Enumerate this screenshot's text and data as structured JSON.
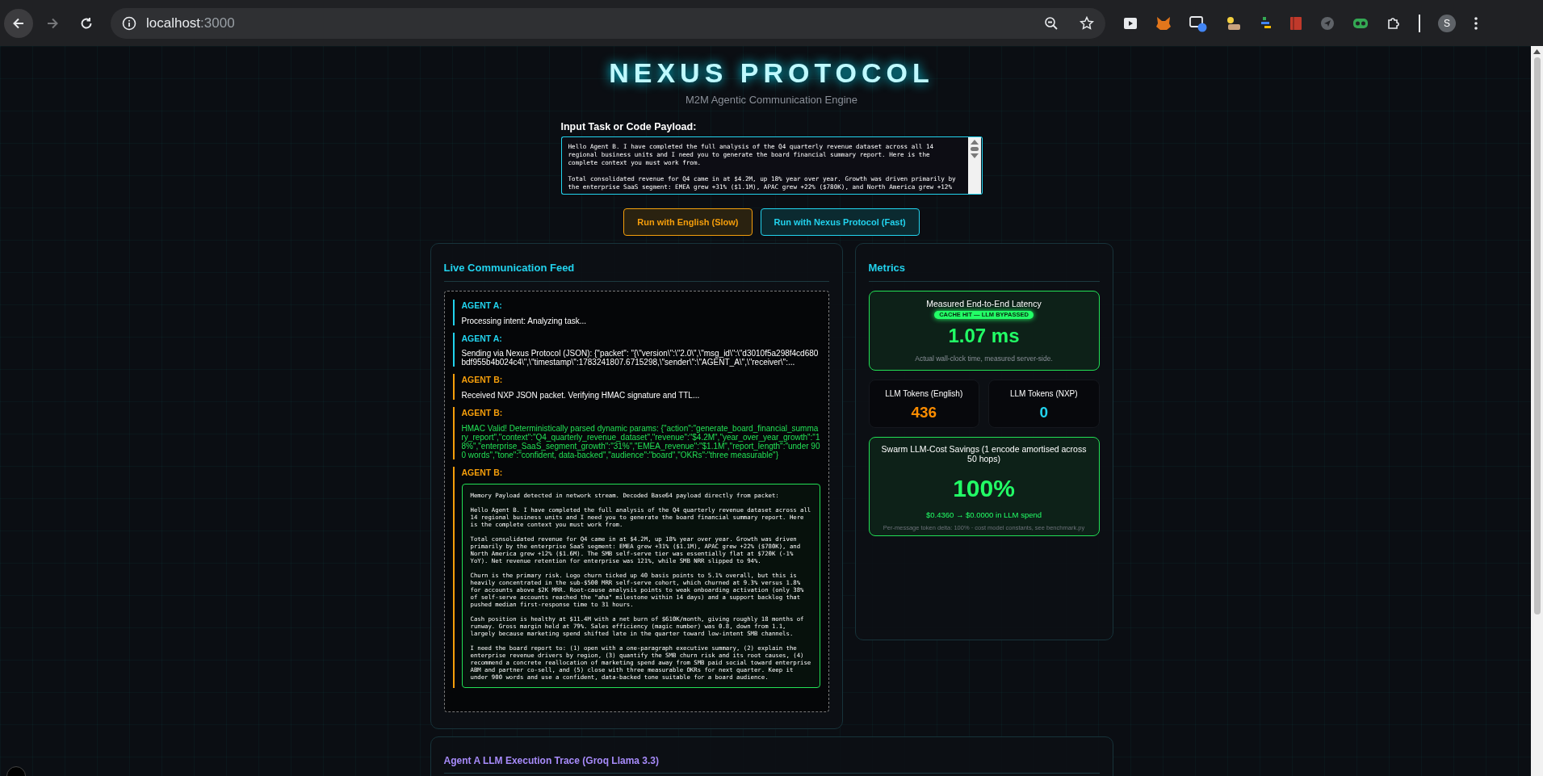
{
  "browser": {
    "url_host": "localhost",
    "url_port": ":3000",
    "profile_initial": "S"
  },
  "header": {
    "title": "NEXUS PROTOCOL",
    "subtitle": "M2M Agentic Communication Engine"
  },
  "input": {
    "label": "Input Task or Code Payload:",
    "value": "Hello Agent B. I have completed the full analysis of the Q4 quarterly revenue dataset across all 14 regional business units and I need you to generate the board financial summary report. Here is the complete context you must work from.\n\nTotal consolidated revenue for Q4 came in at $4.2M, up 18% year over year. Growth was driven primarily by the enterprise SaaS segment: EMEA grew +31% ($1.1M), APAC grew +22% ($780K), and North America grew +12%"
  },
  "buttons": [
    {
      "label": "Run with English (Slow)",
      "kind": "english"
    },
    {
      "label": "Run with Nexus Protocol (Fast)",
      "kind": "nexus"
    }
  ],
  "feed": {
    "title": "Live Communication Feed",
    "messages": [
      {
        "agent": "AGENT A:",
        "kind": "request",
        "text": "Processing intent: Analyzing task..."
      },
      {
        "agent": "AGENT A:",
        "kind": "request",
        "text": "Sending via Nexus Protocol (JSON): {\"packet\": \"{\\\"version\\\":\\\"2.0\\\",\\\"msg_id\\\":\\\"d3010f5a298f4cd680bdf955b4b024c4\\\",\\\"timestamp\\\":1783241807.6715298,\\\"sender\\\":\\\"AGENT_A\\\",\\\"receiver\\\":..."
      },
      {
        "agent": "AGENT B:",
        "kind": "reply",
        "text": "Received NXP JSON packet. Verifying HMAC signature and TTL..."
      },
      {
        "agent": "AGENT B:",
        "kind": "verified",
        "text": "HMAC Valid! Deterministically parsed dynamic params: {\"action\":\"generate_board_financial_summary_report\",\"context\":\"Q4_quarterly_revenue_dataset\",\"revenue\":\"$4.2M\",\"year_over_year_growth\":\"18%\",\"enterprise_SaaS_segment_growth\":\"31%\",\"EMEA_revenue\":\"$1.1M\",\"report_length\":\"under 900 words\",\"tone\":\"confident, data-backed\",\"audience\":\"board\",\"OKRs\":\"three measurable\"}"
      },
      {
        "agent": "AGENT B:",
        "kind": "payload",
        "text": "Memory Payload detected in network stream. Decoded Base64 payload directly from packet:\n\nHello Agent B. I have completed the full analysis of the Q4 quarterly revenue dataset across all 14 regional business units and I need you to generate the board financial summary report. Here is the complete context you must work from.\n\nTotal consolidated revenue for Q4 came in at $4.2M, up 18% year over year. Growth was driven primarily by the enterprise SaaS segment: EMEA grew +31% ($1.1M), APAC grew +22% ($780K), and North America grew +12% ($1.6M). The SMB self-serve tier was essentially flat at $720K (-1% YoY). Net revenue retention for enterprise was 121%, while SMB NRR slipped to 94%.\n\nChurn is the primary risk. Logo churn ticked up 40 basis points to 5.1% overall, but this is heavily concentrated in the sub-$500 MRR self-serve cohort, which churned at 9.3% versus 1.8% for accounts above $2K MRR. Root-cause analysis points to weak onboarding activation (only 38% of self-serve accounts reached the \"aha\" milestone within 14 days) and a support backlog that pushed median first-response time to 31 hours.\n\nCash position is healthy at $11.4M with a net burn of $610K/month, giving roughly 18 months of runway. Gross margin held at 79%. Sales efficiency (magic number) was 0.8, down from 1.1, largely because marketing spend shifted late in the quarter toward low-intent SMB channels.\n\nI need the board report to: (1) open with a one-paragraph executive summary, (2) explain the enterprise revenue drivers by region, (3) quantify the SMB churn risk and its root causes, (4) recommend a concrete reallocation of marketing spend away from SMB paid social toward enterprise ABM and partner co-sell, and (5) close with three measurable OKRs for next quarter. Keep it under 900 words and use a confident, data-backed tone suitable for a board audience."
      }
    ]
  },
  "metrics": {
    "title": "Metrics",
    "latency": {
      "label": "Measured End-to-End Latency",
      "badge": "CACHE HIT — LLM BYPASSED",
      "value": "1.07 ms",
      "note": "Actual wall-clock time, measured server-side."
    },
    "tokens": [
      {
        "label": "LLM Tokens (English)",
        "value": "436",
        "kind": "english"
      },
      {
        "label": "LLM Tokens (NXP)",
        "value": "0",
        "kind": "nexus"
      }
    ],
    "savings": {
      "label": "Swarm LLM-Cost Savings (1 encode amortised across 50 hops)",
      "value": "100%",
      "spend": "$0.4360 → $0.0000 in LLM spend",
      "note": "Per-message token delta: 100% · cost model constants, see benchmark.py"
    }
  },
  "trace": {
    "title": "Agent A LLM Execution Trace (Groq Llama 3.3)"
  }
}
